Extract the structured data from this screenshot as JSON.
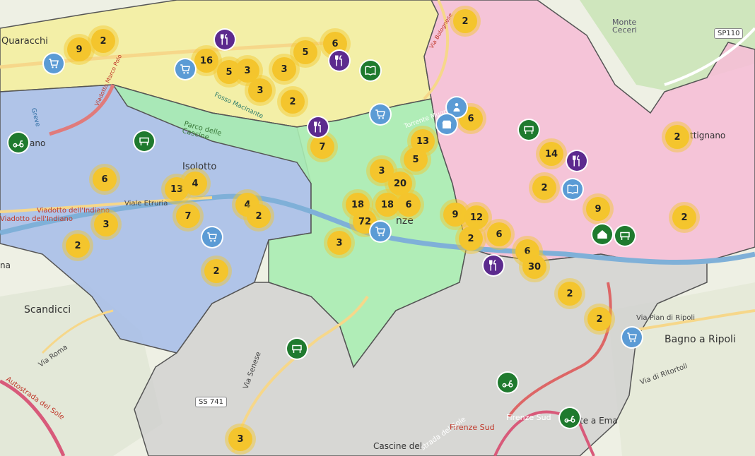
{
  "map": {
    "places": {
      "quaracchi": "Quaracchi",
      "isolotto": "Isolotto",
      "scandicci": "Scandicci",
      "bagno_a_ripoli": "Bagno a Ripoli",
      "monte_ceceri": "Monte\nCeceri",
      "parco_cascine": "Parco delle\nCascine",
      "firenze": "nze",
      "settignano": "ttignano",
      "cascine_del": "Cascine del",
      "firenze_sud_1": "Firenze Sud",
      "firenze_sud_2": "Firenze Sud",
      "ponte_a_ema": "te a Ema",
      "gano": "ano",
      "na": "na"
    },
    "roads": {
      "via_etruria": "Viale Etruria",
      "viadotto_indiano_1": "Viadotto dell'Indiano",
      "viadotto_indiano_2": "Viadotto dell'Indiano",
      "via_roma": "Via Roma",
      "via_senese": "Via Senese",
      "via_pian_di_ripoli": "Via Pian di Ripoli",
      "via_di_ritortoli": "Via di Ritortoli",
      "autostrada_sole": "Autostrada del Sole",
      "strada_sole": "strada del Sole",
      "via_bolognese": "Via Bolognese",
      "viadotto_marco_polo": "Viadotto Marco Polo",
      "torrente_mugnone": "Torrente Mugnone",
      "ss741": "SS 741",
      "sp110": "SP110",
      "fosso_macinante": "Fosso Macinante",
      "greve": "Greve"
    },
    "clusters": [
      {
        "id": "c1",
        "count": "9"
      },
      {
        "id": "c2",
        "count": "2"
      },
      {
        "id": "c3",
        "count": "16"
      },
      {
        "id": "c4",
        "count": "5"
      },
      {
        "id": "c5",
        "count": "3"
      },
      {
        "id": "c6",
        "count": "3"
      },
      {
        "id": "c7",
        "count": "3"
      },
      {
        "id": "c8",
        "count": "2"
      },
      {
        "id": "c9",
        "count": "5"
      },
      {
        "id": "c10",
        "count": "6"
      },
      {
        "id": "c11",
        "count": "2"
      },
      {
        "id": "c12",
        "count": "6"
      },
      {
        "id": "c13",
        "count": "7"
      },
      {
        "id": "c14",
        "count": "13"
      },
      {
        "id": "c15",
        "count": "5"
      },
      {
        "id": "c16",
        "count": "3"
      },
      {
        "id": "c17",
        "count": "20"
      },
      {
        "id": "c18",
        "count": "18"
      },
      {
        "id": "c19",
        "count": "18"
      },
      {
        "id": "c20",
        "count": "6"
      },
      {
        "id": "c21",
        "count": "72"
      },
      {
        "id": "c22",
        "count": "3"
      },
      {
        "id": "c23",
        "count": "6"
      },
      {
        "id": "c24",
        "count": "13"
      },
      {
        "id": "c25",
        "count": "4"
      },
      {
        "id": "c26",
        "count": "7"
      },
      {
        "id": "c27",
        "count": "4"
      },
      {
        "id": "c28",
        "count": "2"
      },
      {
        "id": "c29",
        "count": "3"
      },
      {
        "id": "c30",
        "count": "2"
      },
      {
        "id": "c31",
        "count": "2"
      },
      {
        "id": "c32",
        "count": "14"
      },
      {
        "id": "c33",
        "count": "2"
      },
      {
        "id": "c34",
        "count": "9"
      },
      {
        "id": "c35",
        "count": "9"
      },
      {
        "id": "c36",
        "count": "12"
      },
      {
        "id": "c37",
        "count": "2"
      },
      {
        "id": "c38",
        "count": "6"
      },
      {
        "id": "c39",
        "count": "2"
      },
      {
        "id": "c40",
        "count": "6"
      },
      {
        "id": "c41",
        "count": "30"
      },
      {
        "id": "c42",
        "count": "2"
      },
      {
        "id": "c43",
        "count": "2"
      },
      {
        "id": "c44",
        "count": "2"
      },
      {
        "id": "c45",
        "count": "3"
      }
    ],
    "poi_types": {
      "restaurant": "fork-knife-icon",
      "shop": "shopping-cart-icon",
      "market": "market-stall-icon",
      "library": "book-icon",
      "scooter": "scooter-icon",
      "home": "home-icon",
      "info": "info-icon"
    },
    "colors": {
      "zone_north": "#f3ef9c",
      "zone_west": "#a9bfe8",
      "zone_center": "#a8ecb1",
      "zone_east": "#f5bfd6",
      "zone_south": "#cfcfcf",
      "cluster": "#f4c52d",
      "restaurant": "#5c2a8e",
      "shop": "#5b9bd5",
      "market": "#1f7a2e"
    }
  }
}
